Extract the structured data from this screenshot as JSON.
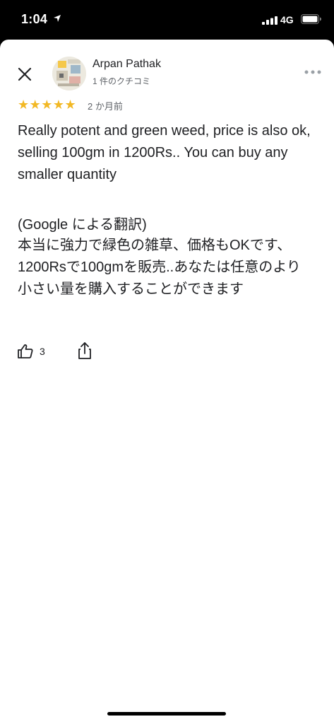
{
  "status_bar": {
    "time": "1:04",
    "network": "4G"
  },
  "review": {
    "author": "Arpan Pathak",
    "author_meta": "1 件のクチコミ",
    "rating": 5,
    "stars": "★★★★★",
    "time_ago": "2 か月前",
    "text": "Really potent and green weed, price is also ok, selling 100gm in 1200Rs.. You can buy any smaller quantity",
    "translation_label": "(Google による翻訳)",
    "translation": "本当に強力で緑色の雑草、価格もOKです、1200Rsで100gmを販売..あなたは任意のより小さい量を購入することができます",
    "like_count": "3"
  },
  "icons": {
    "close": "close-icon",
    "more": "more-icon",
    "thumbs_up": "thumbs-up-icon",
    "share": "share-icon"
  },
  "colors": {
    "star": "#f2b824",
    "text": "#202124",
    "secondary": "#5f6368"
  }
}
